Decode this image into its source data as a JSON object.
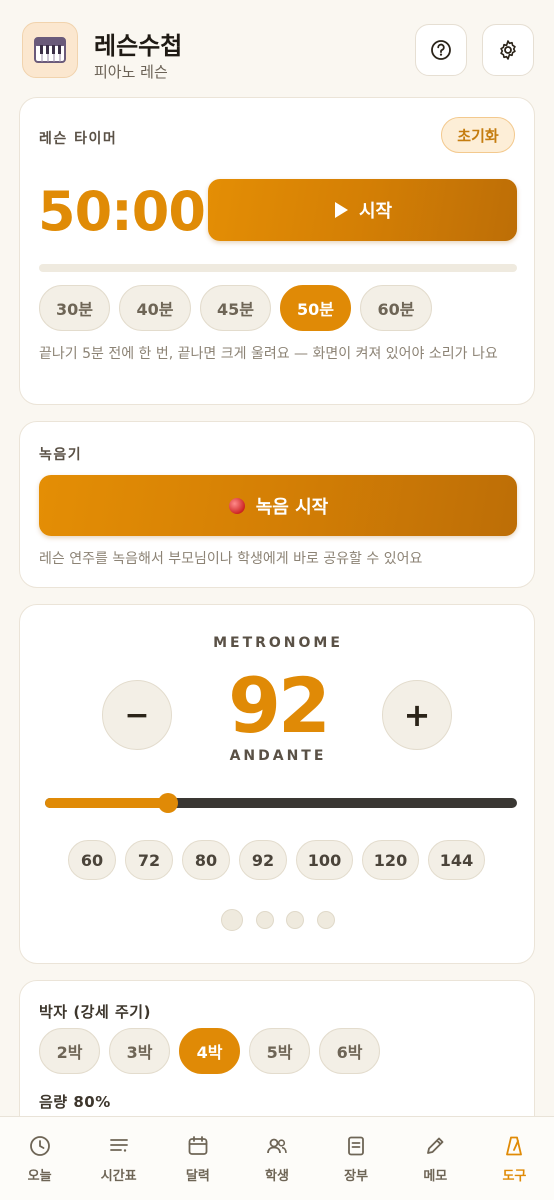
{
  "header": {
    "title": "레슨수첩",
    "subtitle": "피아노 레슨",
    "icons": {
      "app": "piano-icon",
      "help": "question-circle-icon",
      "settings": "gear-icon"
    }
  },
  "timer": {
    "label": "레슨 타이머",
    "reset_label": "초기화",
    "time": "50:00",
    "start_label": "시작",
    "start_icon": "play-icon",
    "progress": 0,
    "presets": [
      {
        "label": "30분",
        "active": false
      },
      {
        "label": "40분",
        "active": false
      },
      {
        "label": "45분",
        "active": false
      },
      {
        "label": "50분",
        "active": true
      },
      {
        "label": "60분",
        "active": false
      }
    ],
    "help": "끝나기 5분 전에 한 번, 끝나면 크게 울려요 — 화면이 켜져 있어야 소리가 나요"
  },
  "recorder": {
    "label": "녹음기",
    "button_label": "녹음 시작",
    "button_icon": "record-dot-icon",
    "help": "레슨 연주를 녹음해서 부모님이나 학생에게 바로 공유할 수 있어요"
  },
  "metronome": {
    "label": "METRONOME",
    "bpm": "92",
    "tempo_name": "ANDANTE",
    "minus_label": "−",
    "plus_label": "+",
    "slider": {
      "min": 40,
      "max": 240,
      "value": 92
    },
    "presets": [
      "60",
      "72",
      "80",
      "92",
      "100",
      "120",
      "144"
    ],
    "beats_total": 4,
    "beat_active": 1
  },
  "beats": {
    "label": "박자 (강세 주기)",
    "options": [
      {
        "label": "2박",
        "active": false
      },
      {
        "label": "3박",
        "active": false
      },
      {
        "label": "4박",
        "active": true
      },
      {
        "label": "5박",
        "active": false
      },
      {
        "label": "6박",
        "active": false
      }
    ],
    "volume_label": "음량 80%"
  },
  "nav": {
    "items": [
      {
        "label": "오늘",
        "icon": "clock-icon",
        "active": false
      },
      {
        "label": "시간표",
        "icon": "list-icon",
        "active": false
      },
      {
        "label": "달력",
        "icon": "calendar-icon",
        "active": false
      },
      {
        "label": "학생",
        "icon": "users-icon",
        "active": false
      },
      {
        "label": "장부",
        "icon": "ledger-icon",
        "active": false
      },
      {
        "label": "메모",
        "icon": "pencil-icon",
        "active": false
      },
      {
        "label": "도구",
        "icon": "metronome-icon",
        "active": true
      }
    ],
    "accent": "#e08a06"
  }
}
